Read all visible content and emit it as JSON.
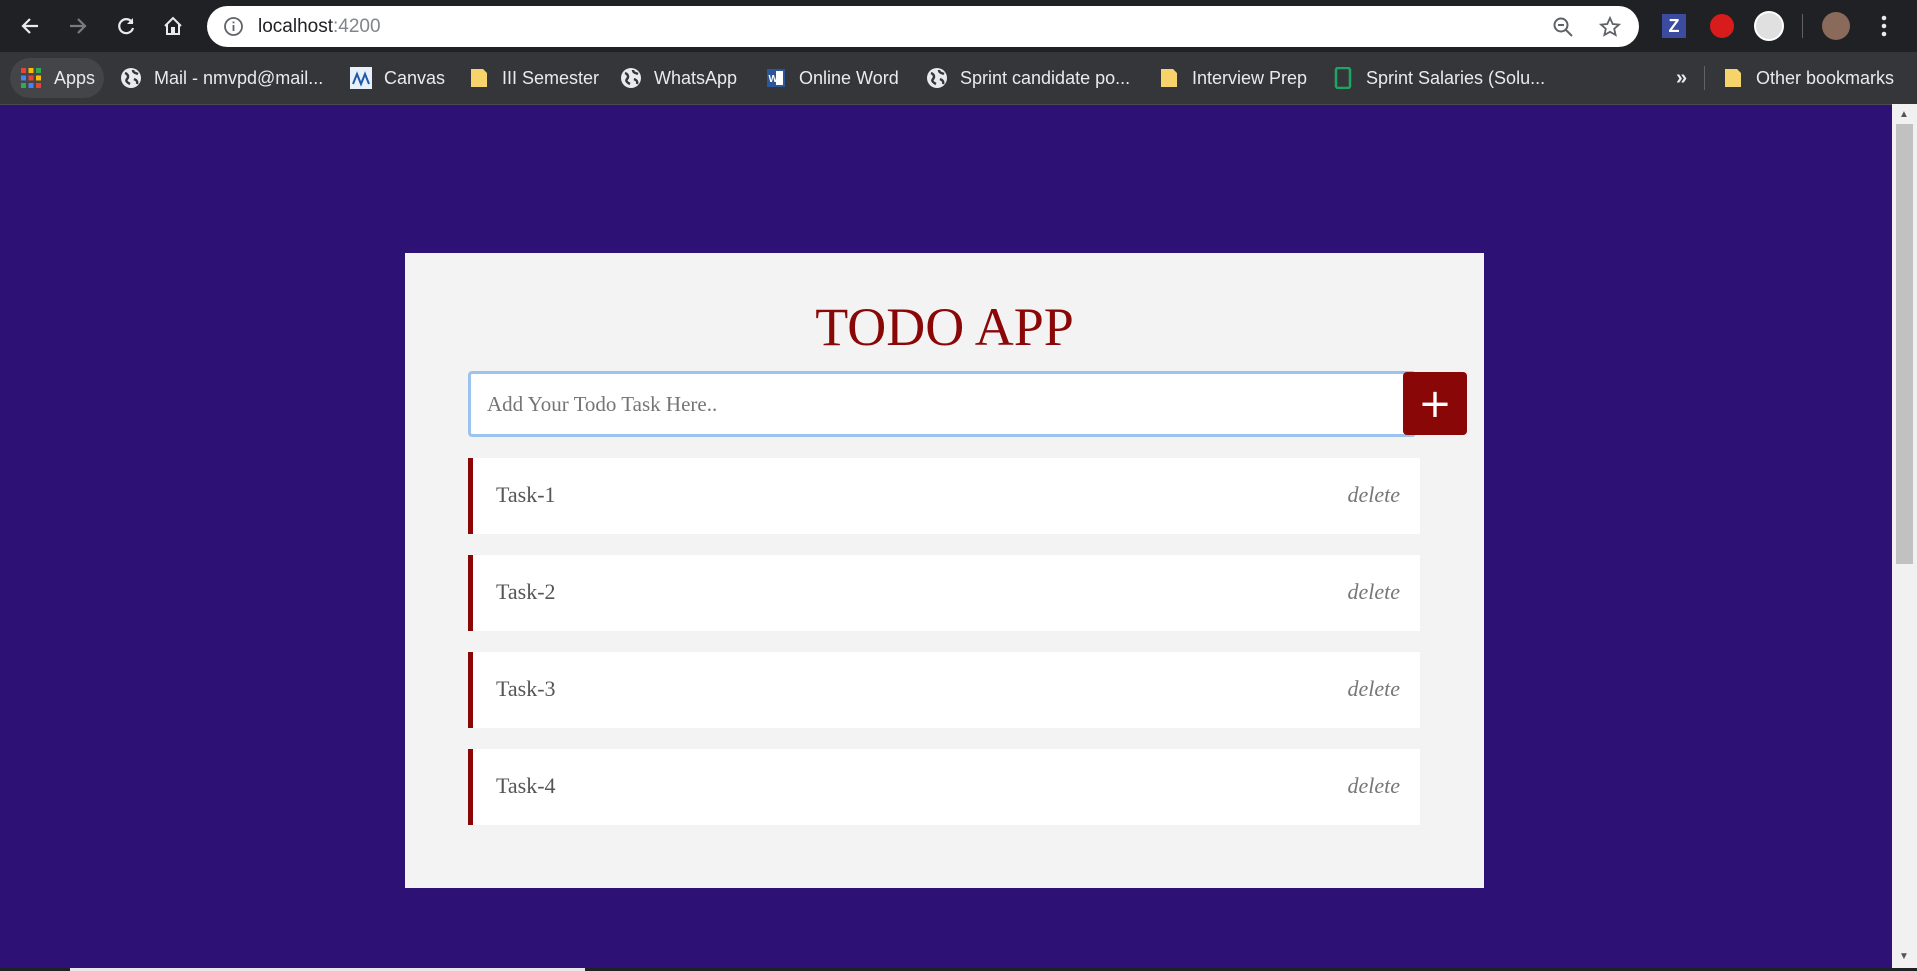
{
  "browser": {
    "url_host": "localhost",
    "url_port": ":4200",
    "bookmarks": [
      {
        "label": "Apps",
        "icon": "apps-grid-icon"
      },
      {
        "label": "Mail - nmvpd@mail...",
        "icon": "globe-icon"
      },
      {
        "label": "Canvas",
        "icon": "canvas-icon"
      },
      {
        "label": "III Semester",
        "icon": "folder-icon"
      },
      {
        "label": "WhatsApp",
        "icon": "globe-icon"
      },
      {
        "label": "Online Word",
        "icon": "word-icon"
      },
      {
        "label": "Sprint candidate po...",
        "icon": "globe-icon"
      },
      {
        "label": "Interview Prep",
        "icon": "folder-icon"
      },
      {
        "label": "Sprint Salaries (Solu...",
        "icon": "sheets-icon"
      }
    ],
    "overflow": "»",
    "other_bookmarks": "Other bookmarks"
  },
  "app": {
    "title": "TODO APP",
    "input_placeholder": "Add Your Todo Task Here..",
    "add_button": "+",
    "tasks": [
      {
        "label": "Task-1",
        "delete": "delete"
      },
      {
        "label": "Task-2",
        "delete": "delete"
      },
      {
        "label": "Task-3",
        "delete": "delete"
      },
      {
        "label": "Task-4",
        "delete": "delete"
      }
    ]
  },
  "colors": {
    "page_background": "#2e1175",
    "accent": "#8a0707",
    "card": "#f3f3f3"
  }
}
